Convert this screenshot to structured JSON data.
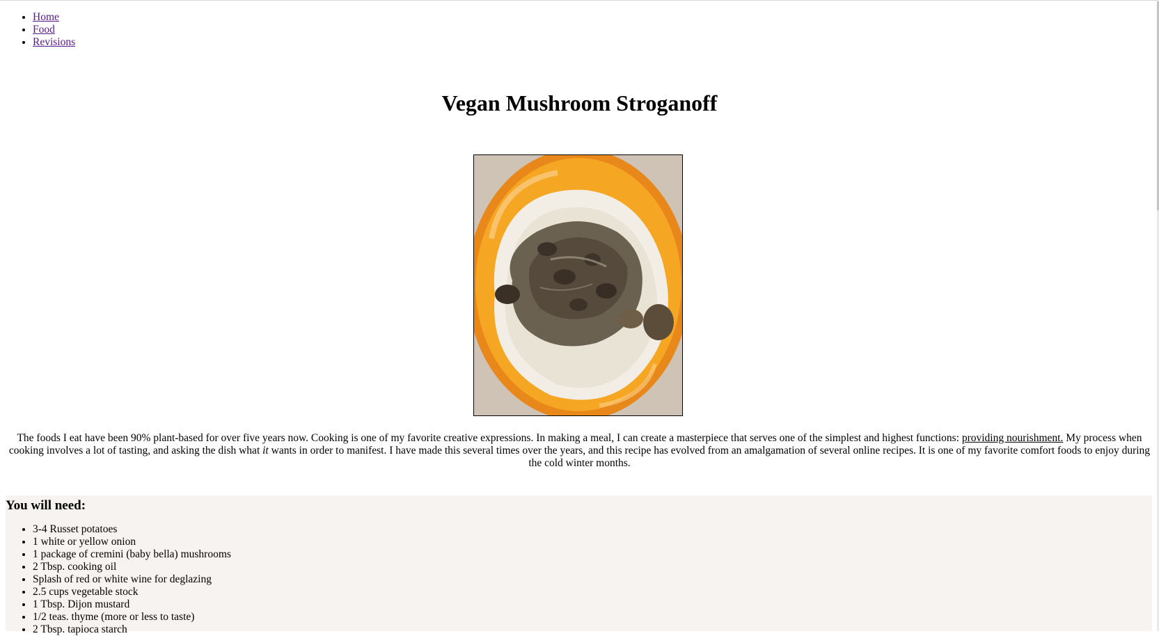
{
  "nav": {
    "items": [
      {
        "label": "Home"
      },
      {
        "label": "Food"
      },
      {
        "label": "Revisions"
      }
    ]
  },
  "page": {
    "title": "Vegan Mushroom Stroganoff"
  },
  "intro": {
    "before_italic": "The foods I eat have been 90% plant-based for over five years now. Cooking is one of my favorite creative expressions. In making a meal, I can create a masterpiece that serves one of the simplest and highest functions: ",
    "link_text": "providing nourishment.",
    "middle": " My process when cooking involves a lot of tasting, and asking the dish what ",
    "italic": "it",
    "after_italic": " wants in order to manifest. I have made this several times over the years, and this recipe has evolved from an amalgamation of several online recipes. It is one of my favorite comfort foods to enjoy during the cold winter months."
  },
  "ingredients": {
    "heading": "You will need:",
    "items": [
      "3-4 Russet potatoes",
      "1 white or yellow onion",
      "1 package of cremini (baby bella) mushrooms",
      "2 Tbsp. cooking oil",
      "Splash of red or white wine for deglazing",
      "2.5 cups vegetable stock",
      "1 Tbsp. Dijon mustard",
      "1/2 teas. thyme (more or less to taste)",
      "2 Tbsp. tapioca starch"
    ]
  },
  "colors": {
    "link": "#551a8b",
    "ingredients_bg": "#f6f3f0",
    "plate": "#f5a623"
  }
}
